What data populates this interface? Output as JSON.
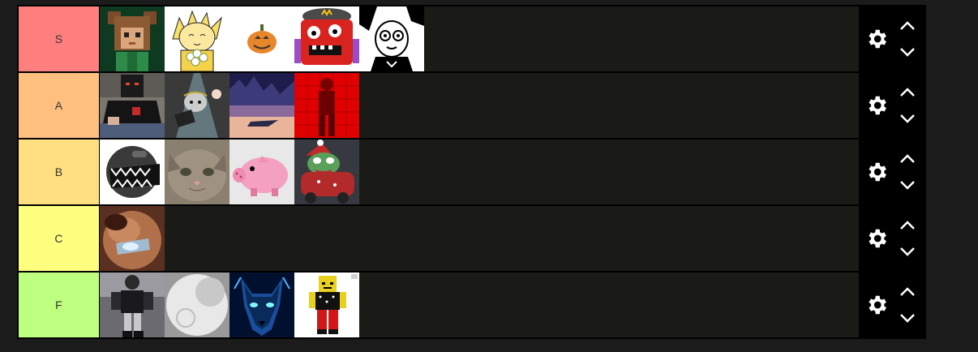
{
  "tiers": [
    {
      "label": "S",
      "color": "#ff7f7f",
      "items": [
        {
          "icon": "pixel-bear-avatar"
        },
        {
          "icon": "blonde-cartoon-with-flowers"
        },
        {
          "icon": "jack-o-lantern-pumpkin"
        },
        {
          "icon": "red-square-monster-with-cap"
        },
        {
          "icon": "black-white-manga-face"
        }
      ]
    },
    {
      "label": "A",
      "color": "#ffbf7f",
      "items": [
        {
          "icon": "masked-person-photo"
        },
        {
          "icon": "ghost-in-light-beam"
        },
        {
          "icon": "purple-sky-landscape"
        },
        {
          "icon": "red-figure-on-red-grid"
        }
      ]
    },
    {
      "label": "B",
      "color": "#ffdf7f",
      "items": [
        {
          "icon": "black-chomping-ball"
        },
        {
          "icon": "kitten-face-photo"
        },
        {
          "icon": "pink-piggy-bank"
        },
        {
          "icon": "frog-in-red-car"
        }
      ]
    },
    {
      "label": "C",
      "color": "#ffff7f",
      "items": [
        {
          "icon": "blurred-face-with-glasses"
        }
      ]
    },
    {
      "label": "F",
      "color": "#bfff7f",
      "items": [
        {
          "icon": "armored-soldier-figure"
        },
        {
          "icon": "grey-moon-circle"
        },
        {
          "icon": "glowing-blue-wolf"
        },
        {
          "icon": "blocky-yellow-character"
        }
      ]
    }
  ],
  "controls": {
    "settings_icon": "gear-icon",
    "move_up_icon": "chevron-up-icon",
    "move_down_icon": "chevron-down-icon"
  }
}
